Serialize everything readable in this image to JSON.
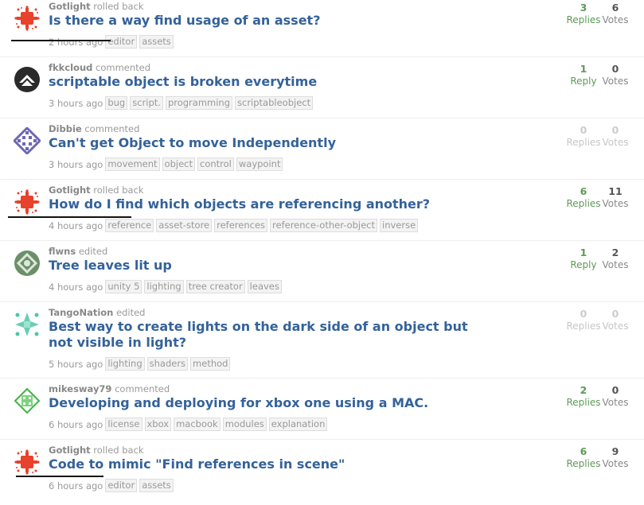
{
  "questions": [
    {
      "user": "Gotlight",
      "action": "rolled back",
      "title": "Is there a way find usage of an asset?",
      "time": "2 hours ago",
      "tags": [
        "editor",
        "assets"
      ],
      "replies": "3",
      "replies_label": "Replies",
      "votes": "6",
      "votes_label": "Votes",
      "avatar_icon": "red-splat-icon"
    },
    {
      "user": "fkkcloud",
      "action": "commented",
      "title": "scriptable object is broken everytime",
      "time": "3 hours ago",
      "tags": [
        "bug",
        "script.",
        "programming",
        "scriptableobject"
      ],
      "replies": "1",
      "replies_label": "Reply",
      "votes": "0",
      "votes_label": "Votes",
      "avatar_icon": "black-chevron-icon"
    },
    {
      "user": "Dibbie",
      "action": "commented",
      "title": "Can't get Object to move Independently",
      "time": "3 hours ago",
      "tags": [
        "movement",
        "object",
        "control",
        "waypoint"
      ],
      "replies": "0",
      "replies_label": "Replies",
      "votes": "0",
      "votes_label": "Votes",
      "avatar_icon": "purple-quilt-icon"
    },
    {
      "user": "Gotlight",
      "action": "rolled back",
      "title": "How do I find which objects are referencing another?",
      "time": "4 hours ago",
      "tags": [
        "reference",
        "asset-store",
        "references",
        "reference-other-object",
        "inverse"
      ],
      "replies": "6",
      "replies_label": "Replies",
      "votes": "11",
      "votes_label": "Votes",
      "avatar_icon": "red-splat-icon"
    },
    {
      "user": "flwns",
      "action": "edited",
      "title": "Tree leaves lit up",
      "time": "4 hours ago",
      "tags": [
        "unity 5",
        "lighting",
        "tree creator",
        "leaves"
      ],
      "replies": "1",
      "replies_label": "Reply",
      "votes": "2",
      "votes_label": "Votes",
      "avatar_icon": "green-knot-icon"
    },
    {
      "user": "TangoNation",
      "action": "edited",
      "title": "Best way to create lights on the dark side of an object but not visible in light?",
      "time": "5 hours ago",
      "tags": [
        "lighting",
        "shaders",
        "method"
      ],
      "replies": "0",
      "replies_label": "Replies",
      "votes": "0",
      "votes_label": "Votes",
      "avatar_icon": "teal-star-icon"
    },
    {
      "user": "mikesway79",
      "action": "commented",
      "title": "Developing and deploying for xbox one using a MAC.",
      "time": "6 hours ago",
      "tags": [
        "license",
        "xbox",
        "macbook",
        "modules",
        "explanation"
      ],
      "replies": "2",
      "replies_label": "Replies",
      "votes": "0",
      "votes_label": "Votes",
      "avatar_icon": "green-grid-icon"
    },
    {
      "user": "Gotlight",
      "action": "rolled back",
      "title": "Code to mimic \"Find references in scene\"",
      "time": "6 hours ago",
      "tags": [
        "editor",
        "assets"
      ],
      "replies": "6",
      "replies_label": "Replies",
      "votes": "9",
      "votes_label": "Votes",
      "avatar_icon": "red-splat-icon"
    }
  ],
  "colors": {
    "title": "#34629a",
    "green_stat": "#5f9a58",
    "zero_stat": "#cccccc",
    "tag_bg": "#f3f3f3",
    "tag_border": "#dddddd"
  }
}
